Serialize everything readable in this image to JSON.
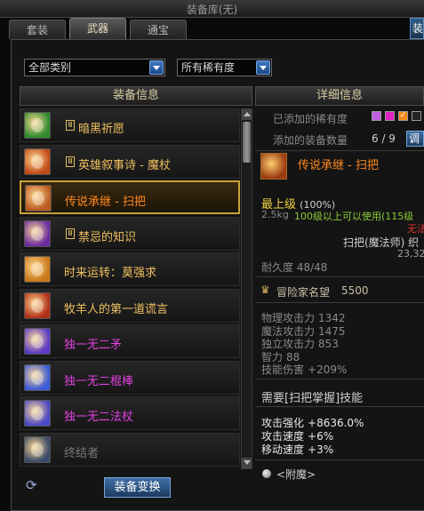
{
  "window": {
    "title": "装备库(无)"
  },
  "tabs": [
    {
      "label": "套装"
    },
    {
      "label": "武器"
    },
    {
      "label": "通宝"
    }
  ],
  "edge_button": {
    "label": "装"
  },
  "filters": {
    "category": "全部类别",
    "rarity": "所有稀有度"
  },
  "left_panel": {
    "title": "装备信息"
  },
  "right_panel": {
    "title": "详细信息"
  },
  "items": [
    {
      "name": "暗黑祈愿",
      "sealed": true,
      "color": "#f0c060",
      "icon_color": "#2e8a2e"
    },
    {
      "name": "英雄叙事诗 - 魔杖",
      "sealed": true,
      "color": "#f0c060",
      "icon_color": "#c24a18"
    },
    {
      "name": "传说承继 - 扫把",
      "sealed": false,
      "color": "#ff8a1e",
      "icon_color": "#b85a20",
      "selected": true
    },
    {
      "name": "禁忌的知识",
      "sealed": true,
      "color": "#f0c060",
      "icon_color": "#6a2aa0"
    },
    {
      "name": "时来运转：莫强求",
      "sealed": false,
      "color": "#f0c060",
      "icon_color": "#c87818"
    },
    {
      "name": "牧羊人的第一道谎言",
      "sealed": false,
      "color": "#f0c060",
      "icon_color": "#b0301a"
    },
    {
      "name": "独一无二矛",
      "sealed": false,
      "color": "#e040e0",
      "icon_color": "#5a3ac8"
    },
    {
      "name": "独一无二棍棒",
      "sealed": false,
      "color": "#e040e0",
      "icon_color": "#3a5ad8"
    },
    {
      "name": "独一无二法杖",
      "sealed": false,
      "color": "#e040e0",
      "icon_color": "#4a48c8"
    },
    {
      "name": "终结者",
      "sealed": false,
      "color": "#7a7a7a",
      "icon_color": "#3a4a6a"
    }
  ],
  "actions": {
    "convert": "装备变换"
  },
  "detail": {
    "added_rarity_label": "已添加的稀有度",
    "added_count_label": "添加的装备数量",
    "added_count_value": "6 / 9",
    "adjust_button": "调",
    "item_name": "传说承继 - 扫把",
    "grade": "最上级",
    "grade_percent": "(100%)",
    "weight": "2.5kg",
    "level_req": "100级以上可以使用(115级",
    "unavailable": "无法",
    "type": "扫把(魔法师) 织",
    "price": "23,32",
    "durability": "耐久度 48/48",
    "reputation_label": "冒险家名望",
    "reputation_value": "5500",
    "stats": [
      {
        "label": "物理攻击力",
        "value": "1342"
      },
      {
        "label": "魔法攻击力",
        "value": "1475"
      },
      {
        "label": "独立攻击力",
        "value": "853"
      },
      {
        "label": "智力",
        "value": "88"
      },
      {
        "label": "技能伤害",
        "value": "+209%"
      }
    ],
    "skill_req": "需要[扫把掌握]技能",
    "bonuses": [
      {
        "label": "攻击强化",
        "value": "+8636.0%"
      },
      {
        "label": "攻击速度",
        "value": "+6%"
      },
      {
        "label": "移动速度",
        "value": "+3%"
      }
    ],
    "enchant": "<附魔>"
  },
  "colors": {
    "gold": "#f0c060",
    "legendary": "#ff8a1e",
    "unique": "#e040e0",
    "highlight_border": "#c9a23a"
  }
}
